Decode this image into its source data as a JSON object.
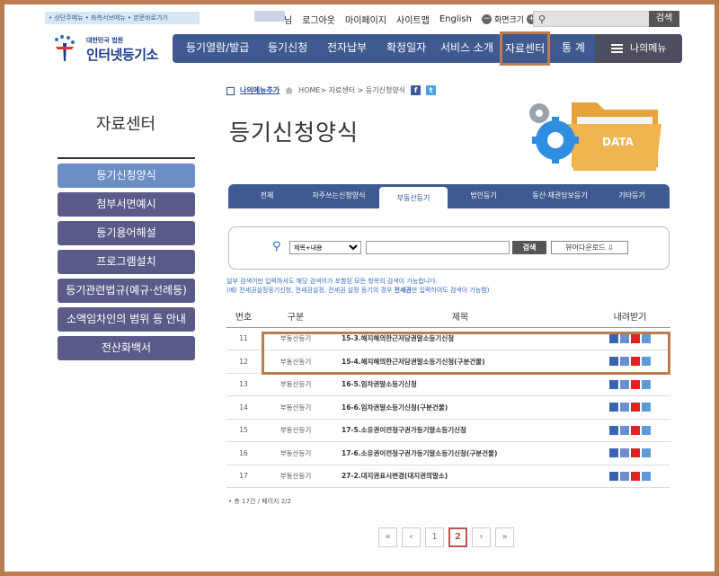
{
  "utility": {
    "skip_links": "• 상단주메뉴 • 좌측서브메뉴 • 본문바로가기",
    "user_suffix": "님",
    "logout": "로그아웃",
    "mypage": "마이페이지",
    "sitemap": "사이트맵",
    "english": "English",
    "zoom_minus": "−",
    "zoom_label": "화면크기",
    "zoom_plus": "+",
    "search_button": "검색"
  },
  "logo": {
    "sub": "대한민국 법원",
    "main": "인터넷등기소"
  },
  "nav": {
    "items": [
      "등기열람/발급",
      "등기신청",
      "전자납부",
      "확정일자",
      "서비스 소개",
      "자료센터",
      "통 계"
    ],
    "active": "자료센터",
    "mymenu": "나의메뉴"
  },
  "sidebar": {
    "title": "자료센터",
    "items": [
      "등기신청양식",
      "첨부서면예시",
      "등기용어해설",
      "프로그램설치",
      "등기관련법규(예규·선례등)",
      "소액임차인의 범위 등 안내",
      "전산화백서"
    ],
    "active": "등기신청양식"
  },
  "breadcrumb": {
    "mymenu_add": "나의메뉴추가",
    "path": "HOME> 자료센터 > 등기신청양식",
    "facebook": "f",
    "twitter": "t"
  },
  "page_title": "등기신청양식",
  "illustration": {
    "label": "DATA"
  },
  "tabs": {
    "items": [
      "전체",
      "자주쓰는신청양식",
      "부동산등기",
      "법인등기",
      "동산·채권담보등기",
      "기타등기"
    ],
    "active": "부동산등기"
  },
  "search": {
    "select_value": "제목+내용",
    "input_value": "",
    "button": "검색",
    "viewer_button": "뷰어다운로드 ⇩"
  },
  "note": {
    "line1": "일부 검색어만 입력하셔도 해당 검색어가 포함된 모든 항목의 검색이 가능합니다.",
    "line2_prefix": "(예) 전세권설정등기신청, 전세권설정, 전세권 설정 등기의 경우 ",
    "line2_bold": "전세권",
    "line2_suffix": "만 입력하여도 검색이 가능함)"
  },
  "table": {
    "headers": [
      "번호",
      "구분",
      "제목",
      "내려받기"
    ],
    "rows": [
      {
        "no": "11",
        "cat": "부동산등기",
        "title": "15-3.해지해의한근저당권말소등기신청"
      },
      {
        "no": "12",
        "cat": "부동산등기",
        "title": "15-4.해지해의한근저당권말소등기신청(구분건물)"
      },
      {
        "no": "13",
        "cat": "부동산등기",
        "title": "16-5.임차권말소등기신청"
      },
      {
        "no": "14",
        "cat": "부동산등기",
        "title": "16-6.임차권말소등기신청(구분건물)"
      },
      {
        "no": "15",
        "cat": "부동산등기",
        "title": "17-5.소유권이전청구권가등기말소등기신청"
      },
      {
        "no": "16",
        "cat": "부동산등기",
        "title": "17-6.소유권이전청구권가등기말소등기신청(구분건물)"
      },
      {
        "no": "17",
        "cat": "부동산등기",
        "title": "27-2.대지권표시변경(대지권의말소)"
      }
    ],
    "download_icons": [
      "word-icon",
      "hwp-icon",
      "pdf-icon",
      "txt-icon"
    ]
  },
  "total": "• 총 17건 / 페이지 2/2",
  "pager": {
    "first": "«",
    "prev": "‹",
    "pages": [
      "1",
      "2"
    ],
    "current": "2",
    "next": "›",
    "last": "»"
  },
  "colors": {
    "nav_bg": "#3e5a90",
    "sidebar_item": "#5b5b8a",
    "sidebar_active": "#6b8ec6",
    "highlight": "#b97d4f"
  }
}
